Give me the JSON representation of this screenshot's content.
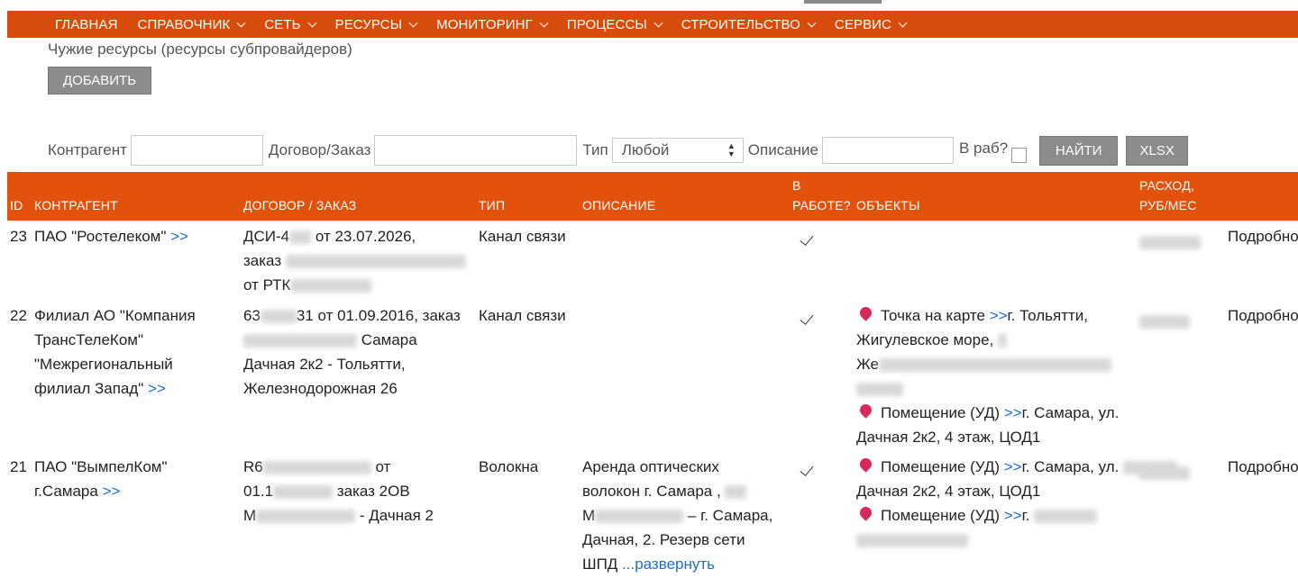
{
  "nav": {
    "items": [
      {
        "label": "ГЛАВНАЯ",
        "dropdown": false
      },
      {
        "label": "СПРАВОЧНИК",
        "dropdown": true
      },
      {
        "label": "СЕТЬ",
        "dropdown": true
      },
      {
        "label": "РЕСУРСЫ",
        "dropdown": true
      },
      {
        "label": "МОНИТОРИНГ",
        "dropdown": true
      },
      {
        "label": "ПРОЦЕССЫ",
        "dropdown": true
      },
      {
        "label": "СТРОИТЕЛЬСТВО",
        "dropdown": true
      },
      {
        "label": "СЕРВИС",
        "dropdown": true
      }
    ]
  },
  "page": {
    "title": "Чужие ресурсы (ресурсы субпровайдеров)",
    "add_label": "ДОБАВИТЬ"
  },
  "filters": {
    "contragent_label": "Контрагент",
    "contract_label": "Договор/Заказ",
    "type_label": "Тип",
    "type_value": "Любой",
    "description_label": "Описание",
    "in_work_label": "В раб?",
    "find_label": "НАЙТИ",
    "xlsx_label": "XLSX"
  },
  "table": {
    "headers": {
      "id": "ID",
      "contragent": "КОНТРАГЕНТ",
      "contract": "ДОГОВОР / ЗАКАЗ",
      "type": "ТИП",
      "description": "ОПИСАНИЕ",
      "in_work_1": "В",
      "in_work_2": "РАБОТЕ?",
      "objects": "ОБЪЕКТЫ",
      "cost_1": "РАСХОД,",
      "cost_2": "РУБ/МЕС"
    },
    "link_arrow": ">>",
    "details_label": "Подробно",
    "expand_label": "...развернуть",
    "rows": [
      {
        "id": "23",
        "contragent": "ПАО \"Ростелеком\"",
        "contract_l1_a": "ДСИ-4",
        "contract_l1_b": "от 23.07.2026,",
        "contract_l2": "заказ",
        "contract_l3": "от РТК",
        "type": "Канал связи",
        "in_work": true
      },
      {
        "id": "22",
        "contragent_l1": "Филиал АО \"Компания",
        "contragent_l2": "ТрансТелеКом\"",
        "contragent_l3": "\"Межрегиональный",
        "contragent_l4": "филиал Запад\"",
        "contract_l1_a": "63",
        "contract_l1_b": "31 от 01.09.2016, заказ",
        "contract_l2": "Самара",
        "contract_l3": "Дачная 2к2 - Тольятти,",
        "contract_l4": "Железнодорожная 26",
        "type": "Канал связи",
        "in_work": true,
        "obj1_label": "Точка на карте",
        "obj1_l1": "г. Тольятти,",
        "obj1_l2": "Жигулевское море,",
        "obj1_l3": "Же",
        "obj2_label": "Помещение (УД)",
        "obj2_l1": "г. Самара, ул.",
        "obj2_l2": "Дачная 2к2, 4 этаж, ЦОД1"
      },
      {
        "id": "21",
        "contragent_l1": "ПАО \"ВымпелКом\"",
        "contragent_l2": "г.Самара",
        "contract_l1_a": "R6",
        "contract_l1_b": "от",
        "contract_l2_a": "01.1",
        "contract_l2_b": "заказ 2ОВ",
        "contract_l3_a": "М",
        "contract_l3_b": "- Дачная 2",
        "type": "Волокна",
        "desc_l1": "Аренда оптических",
        "desc_l2": "волокон г. Самара ,",
        "desc_l3_a": "М",
        "desc_l3_b": "– г. Самара,",
        "desc_l4": "Дачная, 2. Резерв сети",
        "desc_l5": "ШПД",
        "in_work": true,
        "obj1_label": "Помещение (УД)",
        "obj1_l1": "г. Самара, ул.",
        "obj1_l2": "Дачная 2к2, 4 этаж, ЦОД1",
        "obj2_label": "Помещение (УД)",
        "obj2_l1": "г."
      }
    ]
  }
}
